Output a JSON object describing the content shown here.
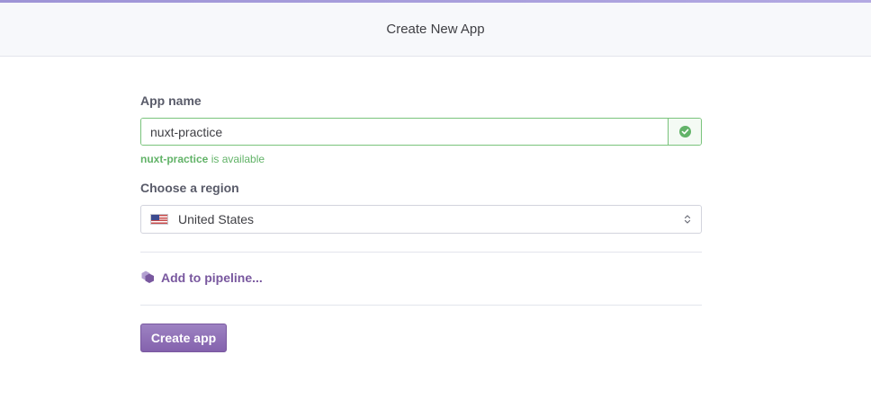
{
  "header": {
    "title": "Create New App"
  },
  "form": {
    "app_name_label": "App name",
    "app_name_value": "nuxt-practice",
    "availability": {
      "app_name": "nuxt-practice",
      "suffix": " is available"
    },
    "region_label": "Choose a region",
    "region_value": "United States",
    "pipeline_link": "Add to pipeline...",
    "create_button": "Create app"
  },
  "colors": {
    "accent_purple": "#79589f",
    "valid_green": "#62b368",
    "header_bg": "#f7f8fb"
  },
  "icons": {
    "valid": "check-circle-icon",
    "region_flag": "us-flag-icon",
    "select": "chevron-up-down-icon",
    "pipeline": "pipeline-hexagon-icon"
  }
}
